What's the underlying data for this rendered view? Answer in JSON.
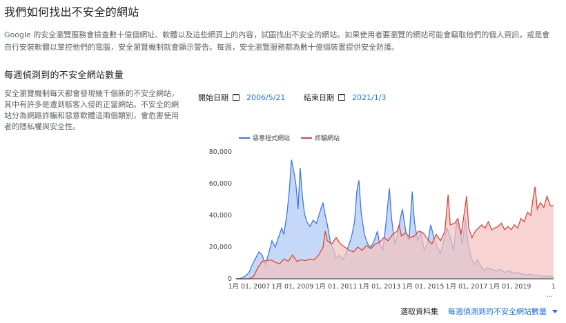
{
  "page": {
    "title": "我們如何找出不安全的網站",
    "intro": "Google 的安全瀏覽服務會檢查數十億個網址、軟體以及這些網頁上的內容，試圖找出不安全的網站。如果使用者要瀏覽的網站可能會竊取他們的個人資訊，或是會自行安裝軟體以掌控他們的電腦，安全瀏覽機制就會顯示警告。每週，安全瀏覽服務都為數十億個裝置提供安全防護。",
    "section_title": "每週偵測到的不安全網站數量",
    "description": "安全瀏覽機制每天都會發現幾千個新的不安全網站，其中有許多是遭到駭客入侵的正當網站。不安全的網站分為網路詐騙和惡意軟體這兩個類別，會危害使用者的隱私權與安全性。"
  },
  "filters": {
    "start_label": "開始日期",
    "start_value": "2006/5/21",
    "end_label": "結束日期",
    "end_value": "2021/1/3",
    "icon": "calendar-icon"
  },
  "dataset": {
    "label": "選取資料集",
    "selected": "每週偵測到的不安全網站數量",
    "icon": "caret-down-icon"
  },
  "chart_data": {
    "type": "area",
    "title": "",
    "xlabel": "",
    "ylabel": "",
    "ylim": [
      0,
      80000
    ],
    "yticks": [
      0,
      20000,
      40000,
      60000,
      80000
    ],
    "ytick_labels": [
      "0",
      "20,000",
      "40,000",
      "60,000",
      "80,000"
    ],
    "xlim": [
      2006.4,
      2021.0
    ],
    "xticks": [
      2007,
      2009,
      2011,
      2013,
      2015,
      2017,
      2019,
      2021
    ],
    "xtick_labels": [
      "1月 01, 2007",
      "1月 01, 2009",
      "1月 01, 2011",
      "1月 01, 2013",
      "1月 01, 2015",
      "1月 01, 2017",
      "1月 01, 2019",
      "1"
    ],
    "legend_position": "top",
    "grid": false,
    "series": [
      {
        "name": "惡意程式網站",
        "color": "#3b78e7",
        "fill": "#bcd1f6",
        "points": [
          [
            2006.4,
            0
          ],
          [
            2006.6,
            200
          ],
          [
            2006.8,
            1500
          ],
          [
            2007.0,
            4000
          ],
          [
            2007.15,
            9000
          ],
          [
            2007.3,
            13000
          ],
          [
            2007.45,
            17000
          ],
          [
            2007.6,
            15000
          ],
          [
            2007.75,
            9000
          ],
          [
            2007.9,
            16000
          ],
          [
            2008.05,
            24000
          ],
          [
            2008.2,
            20000
          ],
          [
            2008.35,
            26000
          ],
          [
            2008.5,
            32000
          ],
          [
            2008.6,
            28000
          ],
          [
            2008.75,
            42000
          ],
          [
            2008.85,
            56000
          ],
          [
            2008.95,
            75000
          ],
          [
            2009.05,
            68000
          ],
          [
            2009.15,
            60000
          ],
          [
            2009.25,
            44000
          ],
          [
            2009.35,
            70000
          ],
          [
            2009.45,
            52000
          ],
          [
            2009.55,
            41000
          ],
          [
            2009.65,
            36000
          ],
          [
            2009.8,
            33000
          ],
          [
            2009.95,
            37000
          ],
          [
            2010.1,
            35000
          ],
          [
            2010.25,
            42000
          ],
          [
            2010.4,
            48000
          ],
          [
            2010.5,
            40000
          ],
          [
            2010.6,
            34000
          ],
          [
            2010.75,
            22000
          ],
          [
            2010.9,
            18000
          ],
          [
            2011.0,
            13000
          ],
          [
            2011.15,
            15000
          ],
          [
            2011.3,
            12000
          ],
          [
            2011.45,
            16000
          ],
          [
            2011.6,
            22000
          ],
          [
            2011.7,
            26000
          ],
          [
            2011.85,
            36000
          ],
          [
            2011.95,
            55000
          ],
          [
            2012.05,
            62000
          ],
          [
            2012.15,
            42000
          ],
          [
            2012.3,
            28000
          ],
          [
            2012.45,
            22000
          ],
          [
            2012.6,
            20000
          ],
          [
            2012.75,
            24000
          ],
          [
            2012.9,
            30000
          ],
          [
            2013.0,
            22000
          ],
          [
            2013.15,
            18000
          ],
          [
            2013.3,
            36000
          ],
          [
            2013.45,
            57000
          ],
          [
            2013.55,
            38000
          ],
          [
            2013.7,
            22000
          ],
          [
            2013.85,
            28000
          ],
          [
            2013.95,
            38000
          ],
          [
            2014.05,
            44000
          ],
          [
            2014.2,
            30000
          ],
          [
            2014.35,
            24000
          ],
          [
            2014.5,
            55000
          ],
          [
            2014.6,
            36000
          ],
          [
            2014.75,
            24000
          ],
          [
            2014.9,
            30000
          ],
          [
            2015.05,
            18000
          ],
          [
            2015.2,
            22000
          ],
          [
            2015.35,
            34000
          ],
          [
            2015.5,
            26000
          ],
          [
            2015.65,
            20000
          ],
          [
            2015.8,
            16000
          ],
          [
            2015.95,
            24000
          ],
          [
            2016.1,
            32000
          ],
          [
            2016.25,
            26000
          ],
          [
            2016.4,
            18000
          ],
          [
            2016.55,
            36000
          ],
          [
            2016.7,
            30000
          ],
          [
            2016.8,
            22000
          ],
          [
            2016.95,
            38000
          ],
          [
            2017.05,
            24000
          ],
          [
            2017.2,
            14000
          ],
          [
            2017.35,
            9000
          ],
          [
            2017.5,
            12000
          ],
          [
            2017.65,
            8000
          ],
          [
            2017.8,
            5000
          ],
          [
            2017.95,
            7000
          ],
          [
            2018.15,
            6000
          ],
          [
            2018.35,
            5000
          ],
          [
            2018.55,
            6000
          ],
          [
            2018.75,
            4000
          ],
          [
            2018.95,
            5000
          ],
          [
            2019.15,
            3500
          ],
          [
            2019.35,
            4000
          ],
          [
            2019.55,
            3000
          ],
          [
            2019.75,
            2500
          ],
          [
            2019.95,
            3000
          ],
          [
            2020.15,
            2000
          ],
          [
            2020.35,
            2200
          ],
          [
            2020.55,
            1500
          ],
          [
            2020.8,
            1800
          ],
          [
            2021.0,
            1200
          ]
        ]
      },
      {
        "name": "詐騙網站",
        "color": "#db4437",
        "fill": "#f4c2bd",
        "points": [
          [
            2006.4,
            0
          ],
          [
            2007.0,
            0
          ],
          [
            2007.2,
            1500
          ],
          [
            2007.4,
            7000
          ],
          [
            2007.6,
            11000
          ],
          [
            2007.8,
            11500
          ],
          [
            2008.0,
            12000
          ],
          [
            2008.2,
            10500
          ],
          [
            2008.4,
            9500
          ],
          [
            2008.6,
            12500
          ],
          [
            2008.8,
            11000
          ],
          [
            2009.0,
            15000
          ],
          [
            2009.2,
            11000
          ],
          [
            2009.4,
            12000
          ],
          [
            2009.6,
            11500
          ],
          [
            2009.8,
            12500
          ],
          [
            2010.0,
            12000
          ],
          [
            2010.2,
            15000
          ],
          [
            2010.4,
            20000
          ],
          [
            2010.5,
            30000
          ],
          [
            2010.6,
            24000
          ],
          [
            2010.8,
            22000
          ],
          [
            2011.0,
            26000
          ],
          [
            2011.2,
            22000
          ],
          [
            2011.4,
            20000
          ],
          [
            2011.6,
            18000
          ],
          [
            2011.8,
            17000
          ],
          [
            2012.0,
            20000
          ],
          [
            2012.2,
            18000
          ],
          [
            2012.4,
            21000
          ],
          [
            2012.6,
            19000
          ],
          [
            2012.8,
            22000
          ],
          [
            2013.0,
            23000
          ],
          [
            2013.2,
            26000
          ],
          [
            2013.4,
            24000
          ],
          [
            2013.6,
            28000
          ],
          [
            2013.8,
            30000
          ],
          [
            2013.9,
            34000
          ],
          [
            2014.0,
            27000
          ],
          [
            2014.2,
            29000
          ],
          [
            2014.4,
            26000
          ],
          [
            2014.6,
            27000
          ],
          [
            2014.8,
            30000
          ],
          [
            2015.0,
            29000
          ],
          [
            2015.2,
            25000
          ],
          [
            2015.4,
            22000
          ],
          [
            2015.6,
            28000
          ],
          [
            2015.8,
            24000
          ],
          [
            2016.0,
            30000
          ],
          [
            2016.15,
            53000
          ],
          [
            2016.25,
            34000
          ],
          [
            2016.45,
            35000
          ],
          [
            2016.6,
            38000
          ],
          [
            2016.75,
            28000
          ],
          [
            2016.9,
            42000
          ],
          [
            2017.0,
            52000
          ],
          [
            2017.1,
            32000
          ],
          [
            2017.25,
            26000
          ],
          [
            2017.4,
            30000
          ],
          [
            2017.55,
            32000
          ],
          [
            2017.7,
            34000
          ],
          [
            2017.85,
            32000
          ],
          [
            2018.0,
            36000
          ],
          [
            2018.15,
            31000
          ],
          [
            2018.3,
            32000
          ],
          [
            2018.45,
            33000
          ],
          [
            2018.6,
            35000
          ],
          [
            2018.75,
            31000
          ],
          [
            2018.9,
            33000
          ],
          [
            2019.05,
            31000
          ],
          [
            2019.2,
            34000
          ],
          [
            2019.35,
            32000
          ],
          [
            2019.5,
            38000
          ],
          [
            2019.65,
            36000
          ],
          [
            2019.8,
            42000
          ],
          [
            2019.95,
            40000
          ],
          [
            2020.05,
            50000
          ],
          [
            2020.15,
            58000
          ],
          [
            2020.25,
            44000
          ],
          [
            2020.4,
            48000
          ],
          [
            2020.55,
            45000
          ],
          [
            2020.7,
            52000
          ],
          [
            2020.85,
            46000
          ],
          [
            2021.0,
            46000
          ]
        ]
      }
    ]
  }
}
